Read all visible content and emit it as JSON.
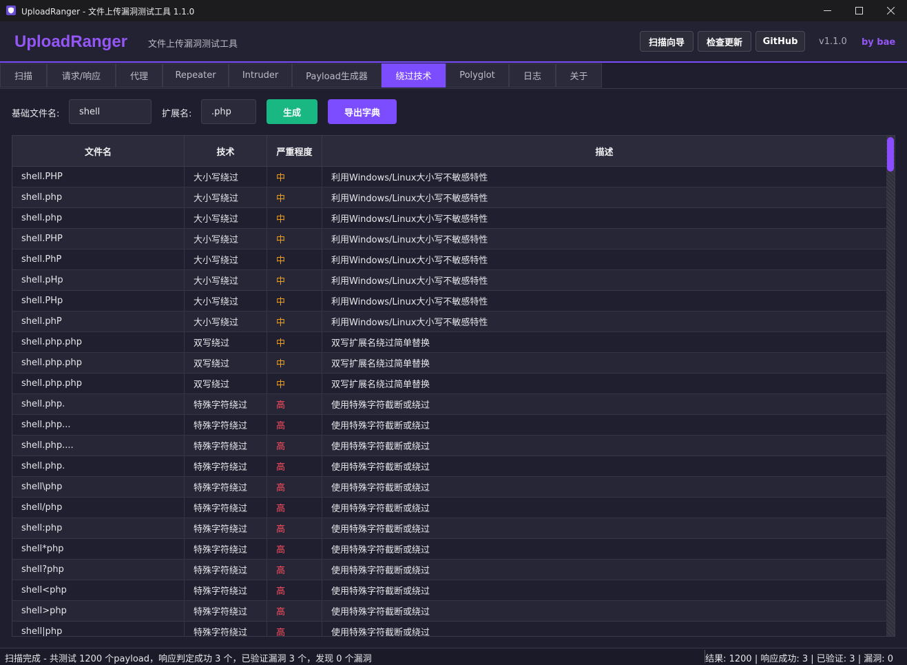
{
  "window": {
    "title": "UploadRanger - 文件上传漏洞测试工具 1.1.0",
    "minimize_icon": "minimize-icon",
    "maximize_icon": "maximize-icon",
    "close_icon": "close-icon"
  },
  "header": {
    "brand": "UploadRanger",
    "subtitle": "文件上传漏洞测试工具",
    "buttons": {
      "wizard": "扫描向导",
      "update": "检查更新",
      "github": "GitHub"
    },
    "version": "v1.1.0",
    "author": "by bae",
    "accent_color": "#7c4dff"
  },
  "tabs": [
    "扫描",
    "请求/响应",
    "代理",
    "Repeater",
    "Intruder",
    "Payload生成器",
    "绕过技术",
    "Polyglot",
    "日志",
    "关于"
  ],
  "active_tab": "绕过技术",
  "form": {
    "base_label": "基础文件名:",
    "base_value": "shell",
    "ext_label": "扩展名:",
    "ext_value": ".php",
    "generate_label": "生成",
    "export_label": "导出字典",
    "generate_color": "#19b883",
    "export_color": "#7c4dff"
  },
  "table": {
    "columns": [
      "文件名",
      "技术",
      "严重程度",
      "描述"
    ],
    "rows": [
      [
        "shell.PHP",
        "大小写绕过",
        "中",
        "利用Windows/Linux大小写不敏感特性"
      ],
      [
        "shell.php",
        "大小写绕过",
        "中",
        "利用Windows/Linux大小写不敏感特性"
      ],
      [
        "shell.php",
        "大小写绕过",
        "中",
        "利用Windows/Linux大小写不敏感特性"
      ],
      [
        "shell.PHP",
        "大小写绕过",
        "中",
        "利用Windows/Linux大小写不敏感特性"
      ],
      [
        "shell.PhP",
        "大小写绕过",
        "中",
        "利用Windows/Linux大小写不敏感特性"
      ],
      [
        "shell.pHp",
        "大小写绕过",
        "中",
        "利用Windows/Linux大小写不敏感特性"
      ],
      [
        "shell.PHp",
        "大小写绕过",
        "中",
        "利用Windows/Linux大小写不敏感特性"
      ],
      [
        "shell.phP",
        "大小写绕过",
        "中",
        "利用Windows/Linux大小写不敏感特性"
      ],
      [
        "shell.php.php",
        "双写绕过",
        "中",
        "双写扩展名绕过简单替换"
      ],
      [
        "shell.php.php",
        "双写绕过",
        "中",
        "双写扩展名绕过简单替换"
      ],
      [
        "shell.php.php",
        "双写绕过",
        "中",
        "双写扩展名绕过简单替换"
      ],
      [
        "shell.php.",
        "特殊字符绕过",
        "高",
        "使用特殊字符截断或绕过"
      ],
      [
        "shell.php...",
        "特殊字符绕过",
        "高",
        "使用特殊字符截断或绕过"
      ],
      [
        "shell.php....",
        "特殊字符绕过",
        "高",
        "使用特殊字符截断或绕过"
      ],
      [
        "shell.php.",
        "特殊字符绕过",
        "高",
        "使用特殊字符截断或绕过"
      ],
      [
        "shell\\php",
        "特殊字符绕过",
        "高",
        "使用特殊字符截断或绕过"
      ],
      [
        "shell/php",
        "特殊字符绕过",
        "高",
        "使用特殊字符截断或绕过"
      ],
      [
        "shell:php",
        "特殊字符绕过",
        "高",
        "使用特殊字符截断或绕过"
      ],
      [
        "shell*php",
        "特殊字符绕过",
        "高",
        "使用特殊字符截断或绕过"
      ],
      [
        "shell?php",
        "特殊字符绕过",
        "高",
        "使用特殊字符截断或绕过"
      ],
      [
        "shell<php",
        "特殊字符绕过",
        "高",
        "使用特殊字符截断或绕过"
      ],
      [
        "shell>php",
        "特殊字符绕过",
        "高",
        "使用特殊字符截断或绕过"
      ],
      [
        "shell|php",
        "特殊字符绕过",
        "高",
        "使用特殊字符截断或绕过"
      ]
    ],
    "severity_colors": {
      "中": "#f0a020",
      "高": "#ff4d5e"
    }
  },
  "status": {
    "left": "扫描完成 - 共测试 1200 个payload，响应判定成功 3 个，已验证漏洞 3 个，发现 0 个漏洞",
    "right": "结果: 1200 | 响应成功: 3 | 已验证: 3 | 漏洞: 0"
  }
}
